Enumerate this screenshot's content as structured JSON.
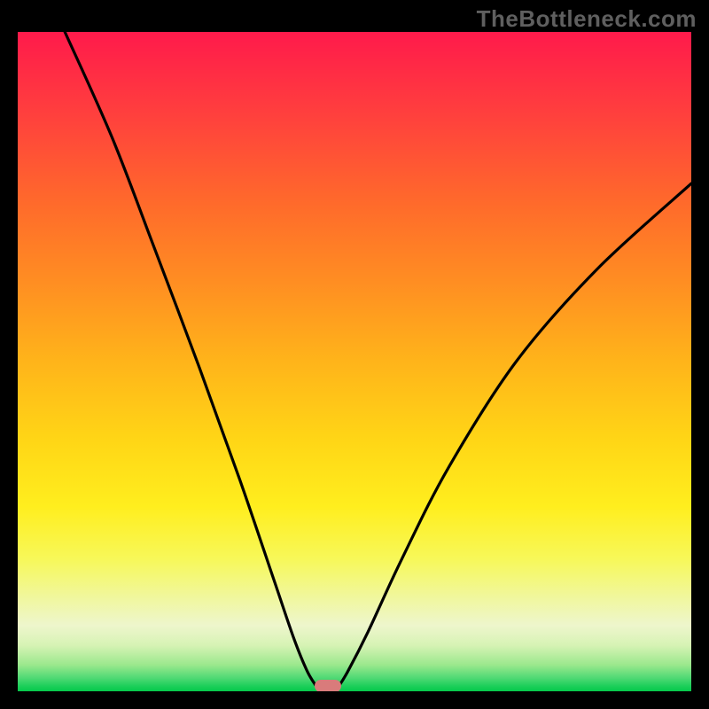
{
  "watermark": "TheBottleneck.com",
  "chart_data": {
    "type": "line",
    "title": "",
    "xlabel": "",
    "ylabel": "",
    "xlim": [
      0,
      100
    ],
    "ylim": [
      0,
      100
    ],
    "background": "vertical-gradient red→green",
    "series": [
      {
        "name": "left-branch",
        "x": [
          7,
          14,
          20,
          27,
          33,
          38,
          41,
          43,
          44.5
        ],
        "y": [
          100,
          84,
          68,
          49,
          32,
          17,
          8,
          3,
          0.5
        ]
      },
      {
        "name": "right-branch",
        "x": [
          47.5,
          49,
          52,
          57,
          64,
          74,
          86,
          100
        ],
        "y": [
          0.5,
          3,
          9,
          20,
          34,
          50,
          64,
          77
        ]
      }
    ],
    "marker": {
      "x": 46,
      "y": 0.5,
      "color": "#d97b7b"
    }
  }
}
